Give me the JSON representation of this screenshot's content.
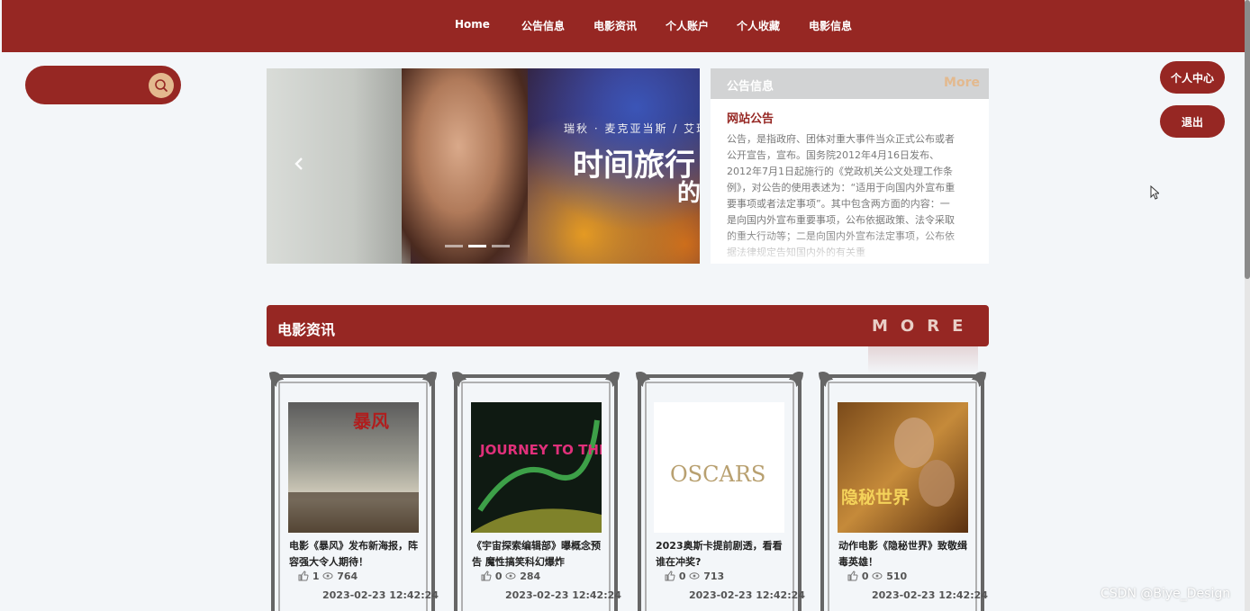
{
  "nav": {
    "items": [
      "Home",
      "公告信息",
      "电影资讯",
      "个人账户",
      "个人收藏",
      "电影信息"
    ]
  },
  "search": {
    "placeholder": ""
  },
  "side": {
    "center_label": "个人中心",
    "logout_label": "退出"
  },
  "banner": {
    "subtitle": "瑞秋 · 麦克亚当斯 / 艾瑞",
    "title": "时间旅行",
    "title2": "的",
    "prev_icon": "chevron-left-icon",
    "slides": 3,
    "active_slide": 2
  },
  "notice": {
    "header": "公告信息",
    "more": "More",
    "title": "网站公告",
    "body": "公告，是指政府、团体对重大事件当众正式公布或者公开宣告，宣布。国务院2012年4月16日发布、2012年7月1日起施行的《党政机关公文处理工作条例》，对公告的使用表述为：“适用于向国内外宣布重要事项或者法定事项”。其中包含两方面的内容：一是向国内外宣布重要事项，公布依据政策、法令采取的重大行动等；二是向国内外宣布法定事项，公布依据法律规定告知国内外的有关重"
  },
  "section": {
    "title": "电影资讯",
    "more": "MORE"
  },
  "cards": [
    {
      "title": "电影《暴风》发布新海报，阵容强大令人期待！",
      "likes": "1",
      "views": "764",
      "date": "2023-02-23 12:42:24",
      "poster_text": "暴风"
    },
    {
      "title": "《宇宙探索编辑部》曝概念预告 魔性搞笑科幻爆炸",
      "likes": "0",
      "views": "284",
      "date": "2023-02-23 12:42:24",
      "poster_text": "JOURNEY TO THE WEST"
    },
    {
      "title": "2023奥斯卡提前剧透，看看谁在冲奖?",
      "likes": "0",
      "views": "713",
      "date": "2023-02-23 12:42:24",
      "poster_text": "OSCARS"
    },
    {
      "title": "动作电影《隐秘世界》致敬缉毒英雄！",
      "likes": "0",
      "views": "510",
      "date": "2023-02-23 12:42:24",
      "poster_text": "隐秘世界"
    }
  ],
  "watermark": "CSDN @Biye_Design",
  "colors": {
    "brand": "#962723",
    "accent": "#e3b98e",
    "background": "#f3f6f9"
  }
}
